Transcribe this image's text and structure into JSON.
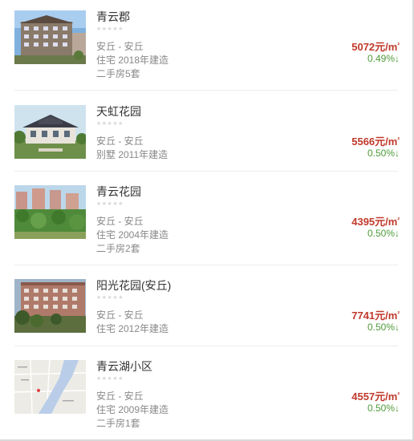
{
  "listings": [
    {
      "name": "青云郡",
      "rating_stars": "★★★★★",
      "district": "安丘 - 安丘",
      "type_year": "住宅 2018年建造",
      "second_hand": "二手房5套",
      "price_value": "5072元/m",
      "price_unit_sup": "²",
      "change_value": "0.49%",
      "change_arrow": "↓",
      "thumb_kind": "apartment"
    },
    {
      "name": "天虹花园",
      "rating_stars": "★★★★★",
      "district": "安丘 - 安丘",
      "type_year": "别墅 2011年建造",
      "second_hand": "",
      "price_value": "5566元/m",
      "price_unit_sup": "²",
      "change_value": "0.50%",
      "change_arrow": "↓",
      "thumb_kind": "villa"
    },
    {
      "name": "青云花园",
      "rating_stars": "★★★★★",
      "district": "安丘 - 安丘",
      "type_year": "住宅 2004年建造",
      "second_hand": "二手房2套",
      "price_value": "4395元/m",
      "price_unit_sup": "²",
      "change_value": "0.50%",
      "change_arrow": "↓",
      "thumb_kind": "garden"
    },
    {
      "name": "阳光花园(安丘)",
      "rating_stars": "★★★★★",
      "district": "安丘 - 安丘",
      "type_year": "住宅 2012年建造",
      "second_hand": "",
      "price_value": "7741元/m",
      "price_unit_sup": "²",
      "change_value": "0.50%",
      "change_arrow": "↓",
      "thumb_kind": "block"
    },
    {
      "name": "青云湖小区",
      "rating_stars": "★★★★★",
      "district": "安丘 - 安丘",
      "type_year": "住宅 2009年建造",
      "second_hand": "二手房1套",
      "price_value": "4557元/m",
      "price_unit_sup": "²",
      "change_value": "0.50%",
      "change_arrow": "↓",
      "thumb_kind": "map"
    }
  ],
  "colors": {
    "price": "#c0392b",
    "change_down": "#4f9a3a",
    "muted_text": "#888888"
  }
}
